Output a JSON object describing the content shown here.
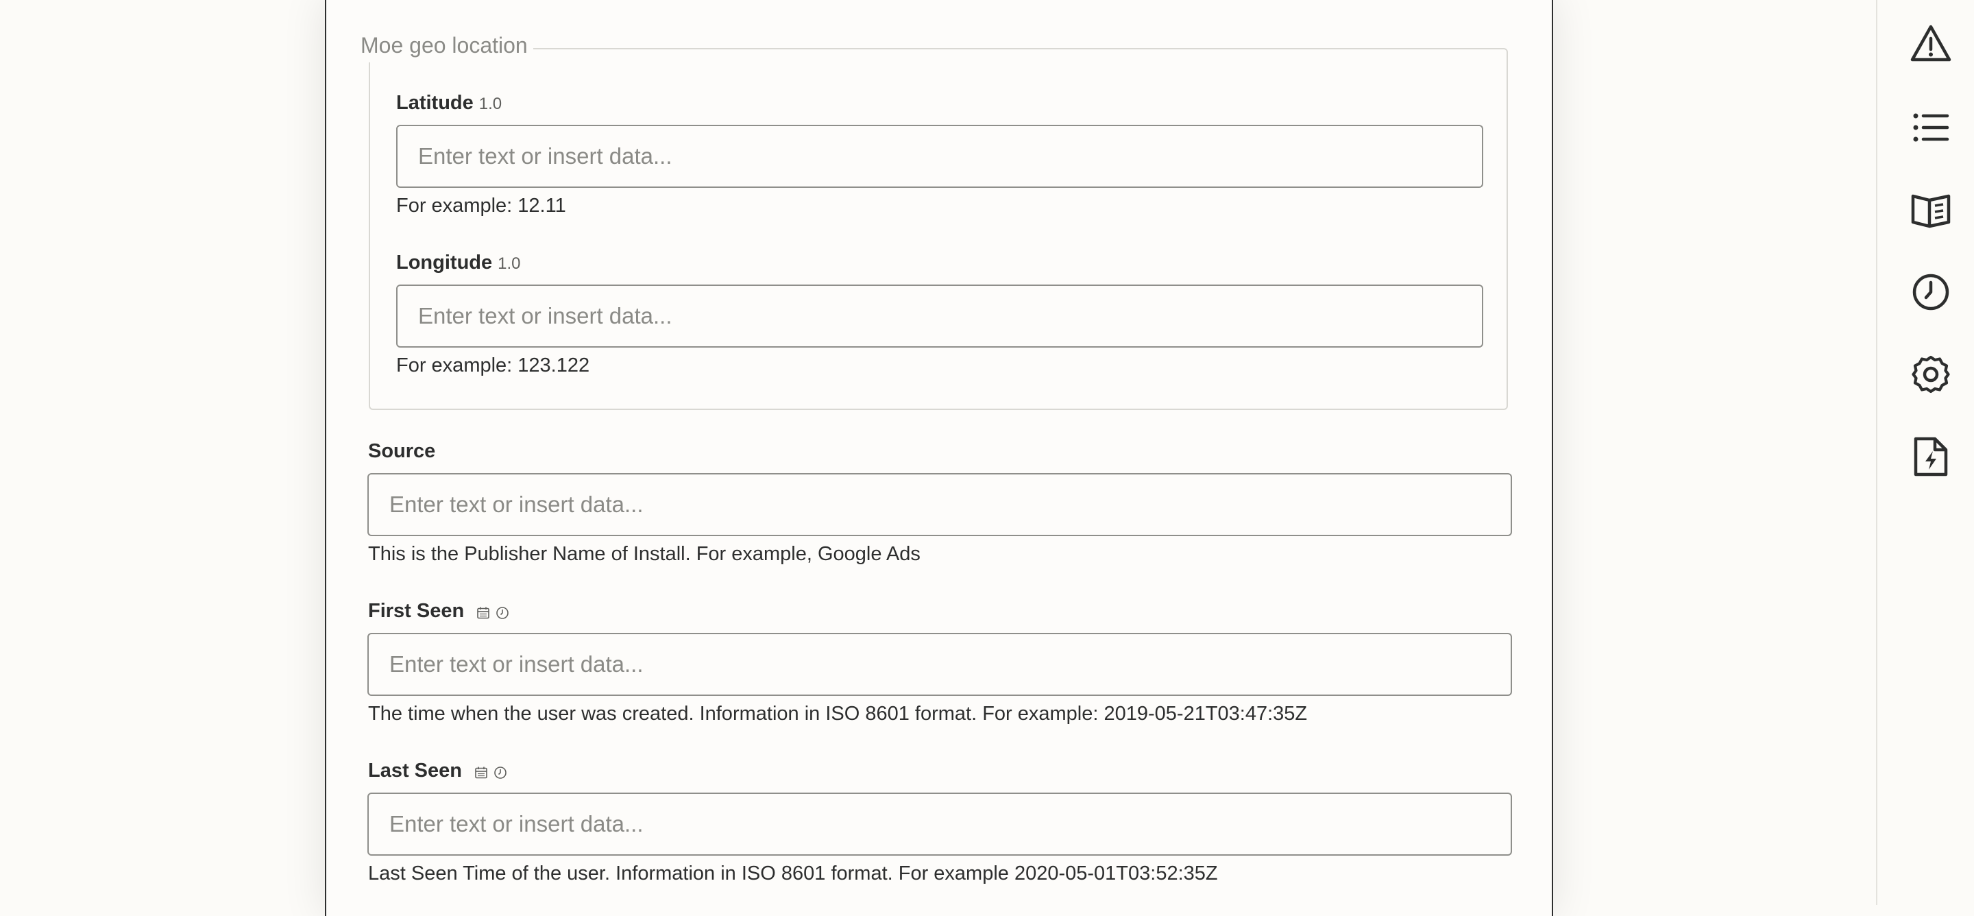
{
  "form": {
    "geo_section": {
      "legend": "Moe geo location",
      "latitude": {
        "label": "Latitude",
        "version": "1.0",
        "placeholder": "Enter text or insert data...",
        "value": "",
        "help": "For example: 12.11"
      },
      "longitude": {
        "label": "Longitude",
        "version": "1.0",
        "placeholder": "Enter text or insert data...",
        "value": "",
        "help": "For example: 123.122"
      }
    },
    "source": {
      "label": "Source",
      "placeholder": "Enter text or insert data...",
      "value": "",
      "help": "This is the Publisher Name of Install. For example, Google Ads"
    },
    "first_seen": {
      "label": "First Seen",
      "type_icons": [
        "calendar-icon",
        "clock-icon"
      ],
      "placeholder": "Enter text or insert data...",
      "value": "",
      "help": "The time when the user was created. Information in ISO 8601 format. For example: 2019-05-21T03:47:35Z"
    },
    "last_seen": {
      "label": "Last Seen",
      "type_icons": [
        "calendar-icon",
        "clock-icon"
      ],
      "placeholder": "Enter text or insert data...",
      "value": "",
      "help": "Last Seen Time of the user. Information in ISO 8601 format. For example 2020-05-01T03:52:35Z"
    }
  },
  "sidebar": {
    "icons": [
      "warning-icon",
      "list-icon",
      "book-icon",
      "clock-icon",
      "gear-icon",
      "zap-file-icon"
    ]
  },
  "colors": {
    "background": "#fcfbf8",
    "text": "#2d2e2e",
    "muted": "#8a8a86",
    "input_border": "#8f8f8b"
  }
}
